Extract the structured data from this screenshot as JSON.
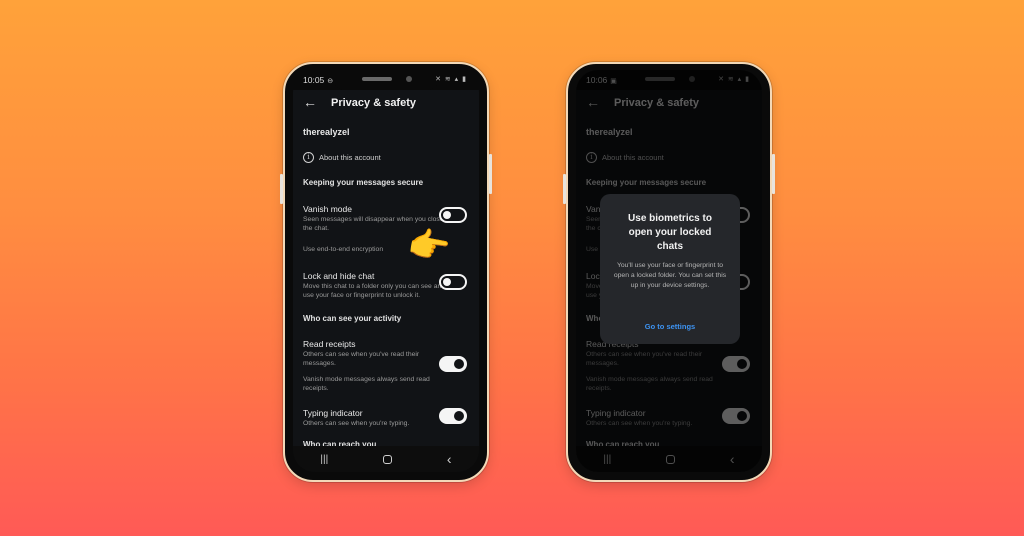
{
  "colors": {
    "background_top": "#ffa23a",
    "background_bottom": "#ff5a56",
    "screen_bg": "#111316",
    "dialog_bg": "#25272b",
    "link_blue": "#3d93f2"
  },
  "phones": [
    {
      "status": {
        "time": "10:05",
        "time_icon": "⊖",
        "right_icons": "✕ ≋ ▴ ▮"
      },
      "header": {
        "back_icon": "←",
        "title": "Privacy & safety"
      },
      "username": "therealyzel",
      "about": {
        "icon": "i",
        "label": "About this account"
      },
      "sections": {
        "secure": "Keeping your messages secure",
        "activity": "Who can see your activity",
        "reach": "Who can reach you"
      },
      "items": [
        {
          "title": "Vanish mode",
          "subtitle": "Seen messages will disappear when you close the chat.",
          "toggle": false
        },
        {
          "title": "",
          "subtitle": "Use end-to-end encryption",
          "toggle": null
        },
        {
          "title": "Lock and hide chat",
          "subtitle": "Move this chat to a folder only you can see and use your face or fingerprint to unlock it.",
          "toggle": false
        },
        {
          "title": "Read receipts",
          "subtitle": "Others can see when you've read their messages.",
          "toggle": true
        },
        {
          "title": "",
          "subtitle": "Vanish mode messages always send read receipts.",
          "toggle": null
        },
        {
          "title": "Typing indicator",
          "subtitle": "Others can see when you're typing.",
          "toggle": true
        }
      ],
      "navbar": {
        "recents": "|||",
        "home": "",
        "back": "‹"
      },
      "pointer_emoji": "👉"
    },
    {
      "status": {
        "time": "10:06",
        "time_icon": "▣",
        "right_icons": "✕ ≋ ▴ ▮"
      },
      "header": {
        "back_icon": "←",
        "title": "Privacy & safety"
      },
      "username": "therealyzel",
      "about": {
        "icon": "i",
        "label": "About this account"
      },
      "sections": {
        "secure": "Keeping your messages secure",
        "activity": "Who can see your activity",
        "reach": "Who can reach you"
      },
      "items": [
        {
          "title": "Vanish mode",
          "subtitle": "Seen messages will disappear when you close the chat.",
          "toggle": false
        },
        {
          "title": "",
          "subtitle": "Use end-to-end encryption",
          "toggle": null
        },
        {
          "title": "Lock and hide chat",
          "subtitle": "Move this chat to a folder only you can see and use your face or fingerprint to unlock it.",
          "toggle": false
        },
        {
          "title": "Read receipts",
          "subtitle": "Others can see when you've read their messages.",
          "toggle": true
        },
        {
          "title": "",
          "subtitle": "Vanish mode messages always send read receipts.",
          "toggle": null
        },
        {
          "title": "Typing indicator",
          "subtitle": "Others can see when you're typing.",
          "toggle": true
        }
      ],
      "navbar": {
        "recents": "|||",
        "home": "",
        "back": "‹"
      },
      "dialog": {
        "title": "Use biometrics to open your locked chats",
        "body": "You'll use your face or fingerprint to open a locked folder. You can set this up in your device settings.",
        "action": "Go to settings"
      }
    }
  ]
}
